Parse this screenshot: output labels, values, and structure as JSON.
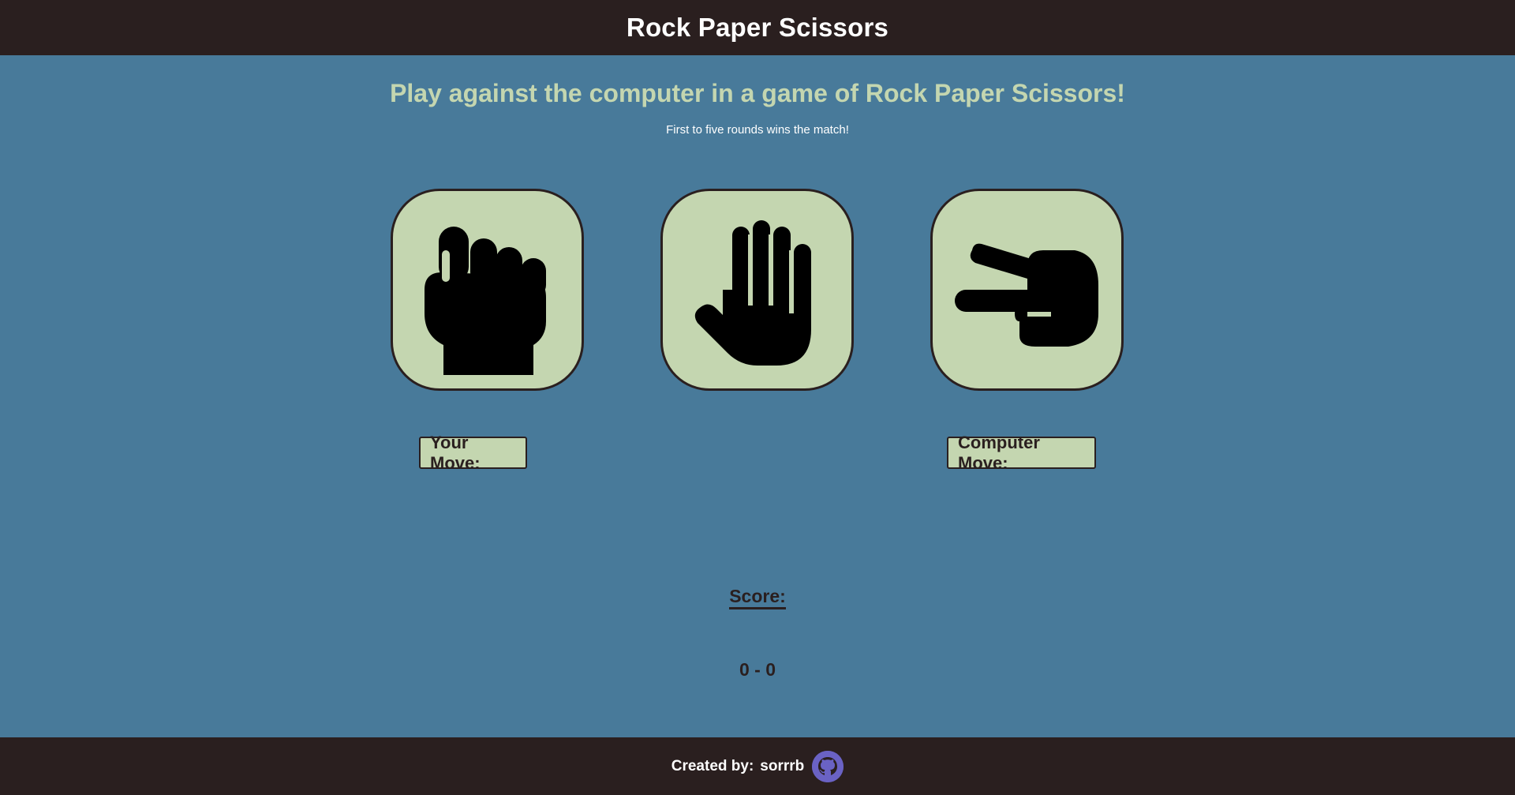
{
  "header": {
    "title": "Rock Paper Scissors"
  },
  "intro": {
    "heading": "Play against the computer in a game of Rock Paper Scissors!",
    "subheading": "First to five rounds wins the match!"
  },
  "moves": [
    {
      "name": "rock",
      "icon": "fist-icon"
    },
    {
      "name": "paper",
      "icon": "open-hand-icon"
    },
    {
      "name": "scissors",
      "icon": "scissors-hand-icon"
    }
  ],
  "labels": {
    "your_move": "Your Move:",
    "computer_move": "Computer Move:"
  },
  "score": {
    "label": "Score:",
    "value": "0 - 0"
  },
  "footer": {
    "created_by": "Created by:",
    "author": "sorrrb",
    "icon": "github-icon"
  },
  "colors": {
    "background": "#487a9a",
    "bar": "#2a1f1f",
    "accent": "#c4d6b0",
    "github": "#6a62c4"
  }
}
